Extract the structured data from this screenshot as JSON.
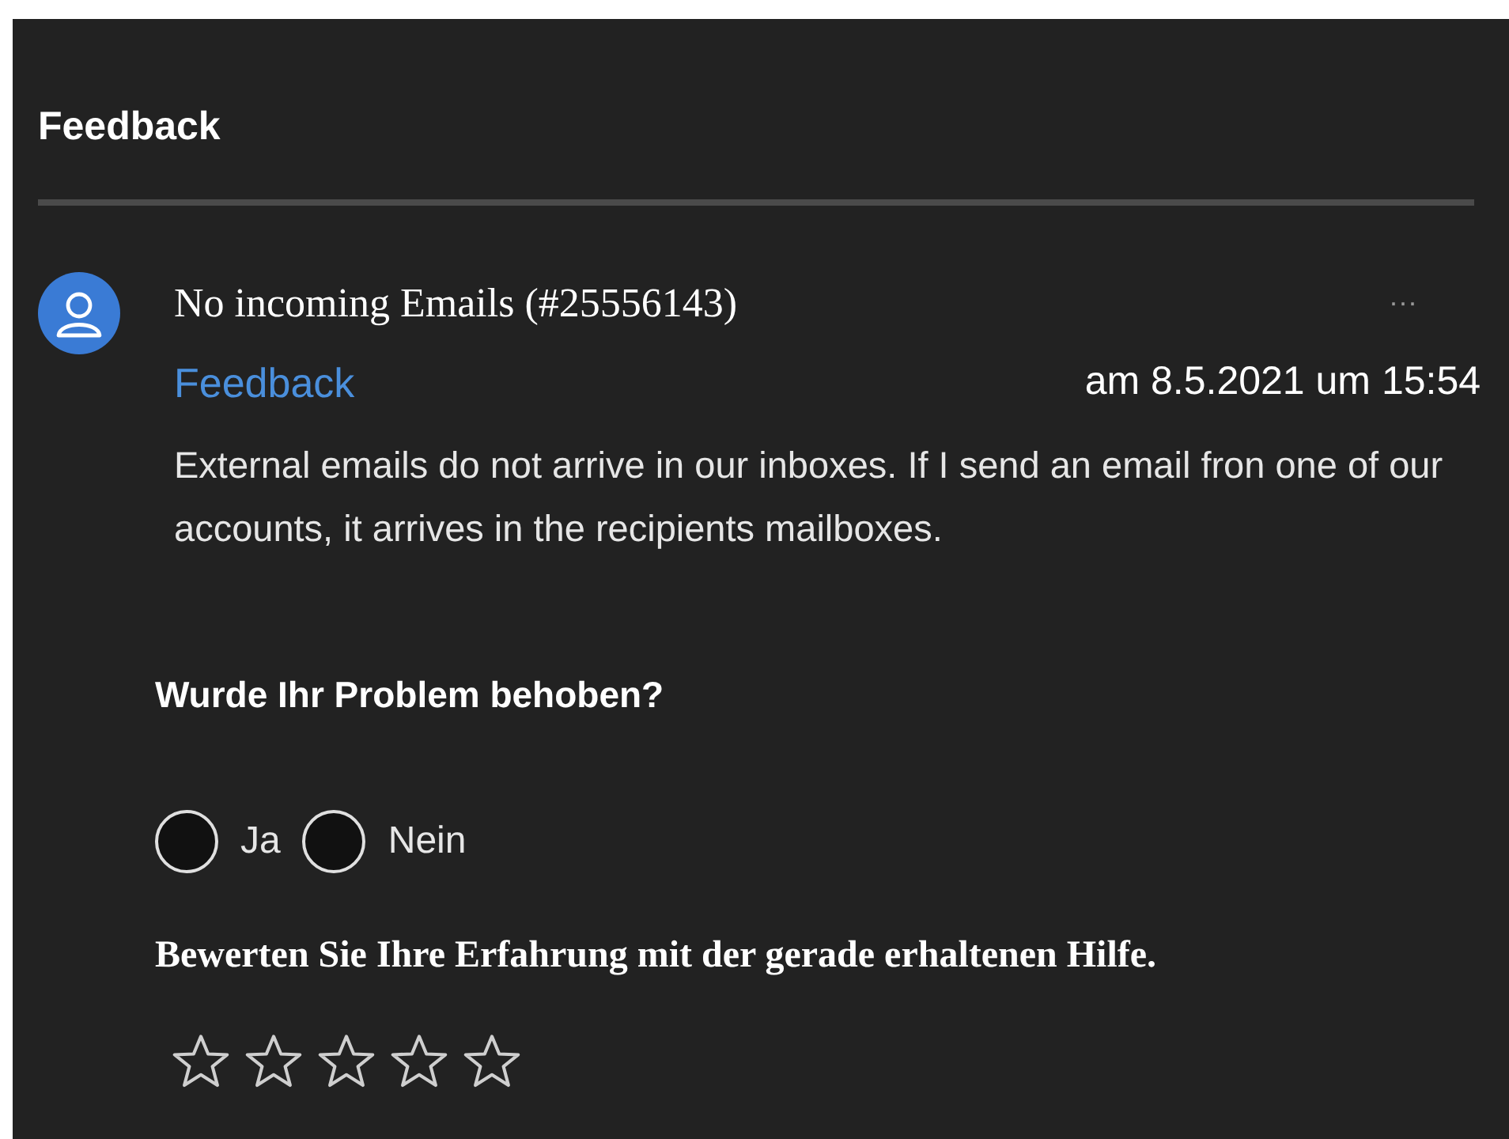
{
  "header": {
    "title": "Feedback"
  },
  "ticket": {
    "title": "No incoming Emails (#25556143)",
    "more": "···",
    "category": "Feedback",
    "date": "am 8.5.2021 um 15:54",
    "body": "External emails do not arrive in our inboxes. If I send an email fron one of our accounts, it arrives in the recipients mailboxes."
  },
  "question": {
    "text": "Wurde Ihr Problem behoben?",
    "options": [
      {
        "label": "Ja",
        "selected": false
      },
      {
        "label": "Nein",
        "selected": false
      }
    ]
  },
  "rating": {
    "text": "Bewerten Sie Ihre Erfahrung mit der gerade erhaltenen Hilfe.",
    "stars": 0
  }
}
